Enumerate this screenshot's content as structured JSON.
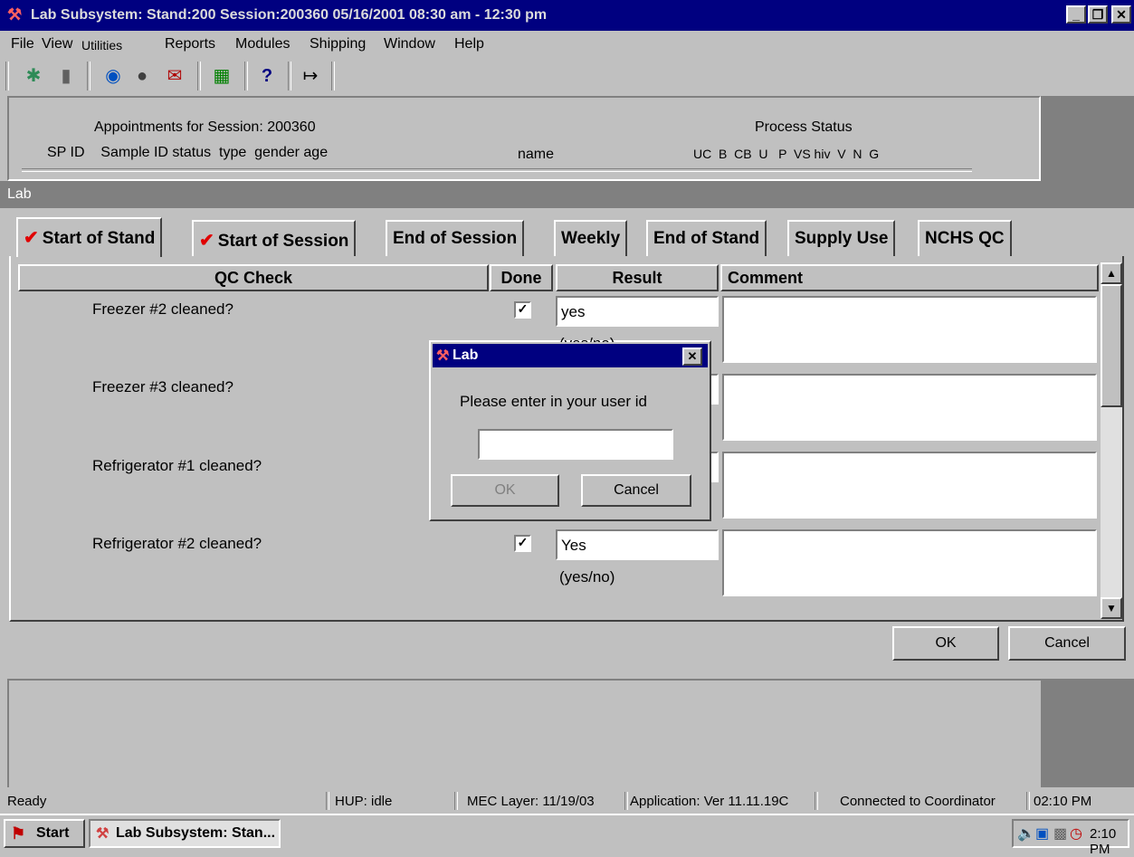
{
  "window": {
    "title": "Lab Subsystem: Stand:200 Session:200360 05/16/2001 08:30 am - 12:30 pm",
    "min_label": "_",
    "max_label": "❐",
    "close_label": "✕"
  },
  "menu": [
    "File",
    "View",
    "Utilities",
    "Reports",
    "Modules",
    "Shipping",
    "Window",
    "Help"
  ],
  "appointments": {
    "title": "Appointments for Session: 200360",
    "columns": "SP ID    Sample ID status  type  gender age",
    "name_col": "name",
    "process_title": "Process Status",
    "process_cols": "UC  B  CB  U   P  VS hiv  V  N  G"
  },
  "lab_bar": "Lab",
  "tabs": [
    {
      "label": "Start of Stand",
      "checked": true,
      "active": true
    },
    {
      "label": "Start of Session",
      "checked": true,
      "active": false
    },
    {
      "label": "End of Session",
      "checked": false,
      "active": false
    },
    {
      "label": "Weekly",
      "checked": false,
      "active": false
    },
    {
      "label": "End of Stand",
      "checked": false,
      "active": false
    },
    {
      "label": "Supply Use",
      "checked": false,
      "active": false
    },
    {
      "label": "NCHS QC",
      "checked": false,
      "active": false
    }
  ],
  "check_mark": "✔",
  "columns": {
    "qc": "QC Check",
    "done": "Done",
    "result": "Result",
    "comment": "Comment"
  },
  "rows": [
    {
      "question": "Freezer #2 cleaned?",
      "done": true,
      "result": "yes",
      "hint": "(yes/no)"
    },
    {
      "question": "Freezer #3 cleaned?",
      "done": true,
      "result": "",
      "hint": ""
    },
    {
      "question": "Refrigerator #1 cleaned?",
      "done": true,
      "result": "",
      "hint": ""
    },
    {
      "question": "Refrigerator #2 cleaned?",
      "done": true,
      "result": "Yes",
      "hint": "(yes/no)"
    }
  ],
  "footer_buttons": {
    "ok": "OK",
    "cancel": "Cancel"
  },
  "dialog": {
    "title": "Lab",
    "close": "✕",
    "prompt": "Please enter in your user id",
    "input_value": "",
    "ok": "OK",
    "cancel": "Cancel"
  },
  "status": {
    "ready": "Ready",
    "hup": "HUP: idle",
    "mec": "MEC Layer: 11/19/03",
    "app": "Application: Ver 11.11.19C",
    "conn": "Connected to Coordinator",
    "time": "02:10 PM"
  },
  "taskbar": {
    "start": "Start",
    "task": "Lab Subsystem: Stan...",
    "clock": "2:10 PM"
  }
}
